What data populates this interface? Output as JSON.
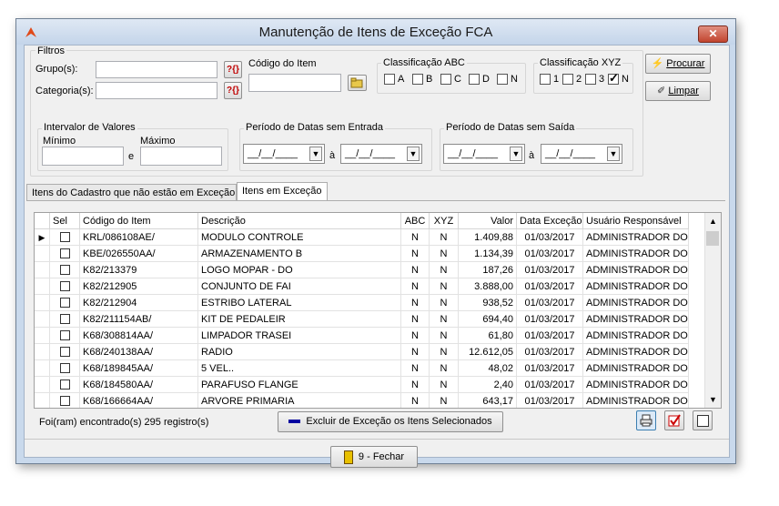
{
  "window": {
    "title": "Manutenção de Itens de Exceção FCA",
    "close_glyph": "✕"
  },
  "filters": {
    "group_title": "Filtros",
    "grupo_label": "Grupo(s):",
    "categoria_label": "Categoria(s):",
    "codigo_label": "Código do Item",
    "abc": {
      "title": "Classificação ABC",
      "options": [
        {
          "label": "A",
          "checked": false
        },
        {
          "label": "B",
          "checked": false
        },
        {
          "label": "C",
          "checked": false
        },
        {
          "label": "D",
          "checked": false
        },
        {
          "label": "N",
          "checked": false
        }
      ]
    },
    "xyz": {
      "title": "Classificação XYZ",
      "options": [
        {
          "label": "1",
          "checked": false
        },
        {
          "label": "2",
          "checked": false
        },
        {
          "label": "3",
          "checked": false
        },
        {
          "label": "N",
          "checked": true
        }
      ]
    },
    "valores": {
      "title": "Intervalor de Valores",
      "min_label": "Mínimo",
      "max_label": "Máximo",
      "conj": "e"
    },
    "entrada": {
      "title": "Período de Datas sem Entrada",
      "from": "__/__/____",
      "to": "__/__/____",
      "conj": "à"
    },
    "saida": {
      "title": "Período de Datas sem Saída",
      "from": "__/__/____",
      "to": "__/__/____",
      "conj": "à"
    },
    "lookup_glyph": "?{}",
    "procurar_label": "Procurar",
    "limpar_label": "Limpar"
  },
  "tabs": [
    {
      "label": "Itens do Cadastro que não estão em Exceção",
      "active": false
    },
    {
      "label": "Itens em Exceção",
      "active": true
    }
  ],
  "grid": {
    "columns": [
      "Sel",
      "Código do Item",
      "Descrição",
      "ABC",
      "XYZ",
      "Valor",
      "Data Exceção",
      "Usuário Responsável"
    ],
    "rows": [
      {
        "sel": false,
        "codigo": "KRL/086108AE/",
        "descricao": "MODULO CONTROLE",
        "abc": "N",
        "xyz": "N",
        "valor": "1.409,88",
        "data": "01/03/2017",
        "usuario": "ADMINISTRADOR DO S",
        "current": true
      },
      {
        "sel": false,
        "codigo": "KBE/026550AA/",
        "descricao": "ARMAZENAMENTO B",
        "abc": "N",
        "xyz": "N",
        "valor": "1.134,39",
        "data": "01/03/2017",
        "usuario": "ADMINISTRADOR DO S",
        "current": false
      },
      {
        "sel": false,
        "codigo": "K82/213379",
        "descricao": "LOGO MOPAR - DO",
        "abc": "N",
        "xyz": "N",
        "valor": "187,26",
        "data": "01/03/2017",
        "usuario": "ADMINISTRADOR DO S",
        "current": false
      },
      {
        "sel": false,
        "codigo": "K82/212905",
        "descricao": "CONJUNTO DE FAI",
        "abc": "N",
        "xyz": "N",
        "valor": "3.888,00",
        "data": "01/03/2017",
        "usuario": "ADMINISTRADOR DO S",
        "current": false
      },
      {
        "sel": false,
        "codigo": "K82/212904",
        "descricao": "ESTRIBO LATERAL",
        "abc": "N",
        "xyz": "N",
        "valor": "938,52",
        "data": "01/03/2017",
        "usuario": "ADMINISTRADOR DO S",
        "current": false
      },
      {
        "sel": false,
        "codigo": "K82/211154AB/",
        "descricao": "KIT DE PEDALEIR",
        "abc": "N",
        "xyz": "N",
        "valor": "694,40",
        "data": "01/03/2017",
        "usuario": "ADMINISTRADOR DO S",
        "current": false
      },
      {
        "sel": false,
        "codigo": "K68/308814AA/",
        "descricao": "LIMPADOR TRASEI",
        "abc": "N",
        "xyz": "N",
        "valor": "61,80",
        "data": "01/03/2017",
        "usuario": "ADMINISTRADOR DO S",
        "current": false
      },
      {
        "sel": false,
        "codigo": "K68/240138AA/",
        "descricao": "RADIO",
        "abc": "N",
        "xyz": "N",
        "valor": "12.612,05",
        "data": "01/03/2017",
        "usuario": "ADMINISTRADOR DO S",
        "current": false
      },
      {
        "sel": false,
        "codigo": "K68/189845AA/",
        "descricao": "5 VEL..",
        "abc": "N",
        "xyz": "N",
        "valor": "48,02",
        "data": "01/03/2017",
        "usuario": "ADMINISTRADOR DO S",
        "current": false
      },
      {
        "sel": false,
        "codigo": "K68/184580AA/",
        "descricao": "PARAFUSO FLANGE",
        "abc": "N",
        "xyz": "N",
        "valor": "2,40",
        "data": "01/03/2017",
        "usuario": "ADMINISTRADOR DO S",
        "current": false
      },
      {
        "sel": false,
        "codigo": "K68/166664AA/",
        "descricao": "ARVORE PRIMARIA",
        "abc": "N",
        "xyz": "N",
        "valor": "643,17",
        "data": "01/03/2017",
        "usuario": "ADMINISTRADOR DO S",
        "current": false
      }
    ]
  },
  "footer": {
    "count_text": "Foi(ram) encontrado(s) 295 registro(s)",
    "excluir_label": "Excluir de Exceção os Itens Selecionados",
    "fechar_label": "9 - Fechar"
  },
  "colors": {
    "window_frame": "#c9d9ec",
    "client": "#f0f0f0",
    "close": "#c2452f",
    "accent_icon": "#0000a0"
  }
}
